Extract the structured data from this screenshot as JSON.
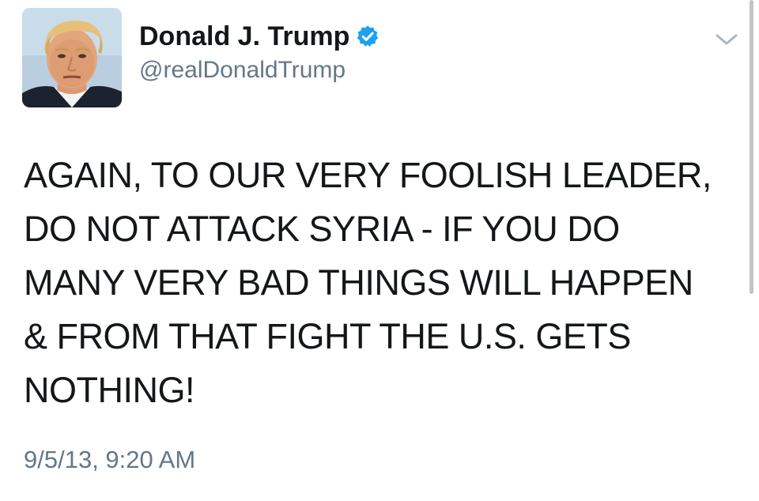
{
  "author": {
    "display_name": "Donald J. Trump",
    "handle": "@realDonaldTrump",
    "verified": true,
    "avatar_icon": "profile-photo"
  },
  "tweet": {
    "lines": [
      "AGAIN, TO OUR VERY FOOLISH LEADER,",
      "DO NOT ATTACK SYRIA - IF YOU DO",
      "MANY VERY BAD THINGS WILL HAPPEN",
      "& FROM THAT FIGHT THE U.S. GETS",
      "NOTHING!"
    ],
    "timestamp": "9/5/13, 9:20 AM"
  },
  "icons": {
    "verified": "verified-badge-icon",
    "menu": "chevron-down-icon"
  },
  "colors": {
    "verified_blue": "#1da1f2",
    "text": "#14171a",
    "secondary_text": "#657786",
    "background": "#ffffff"
  }
}
